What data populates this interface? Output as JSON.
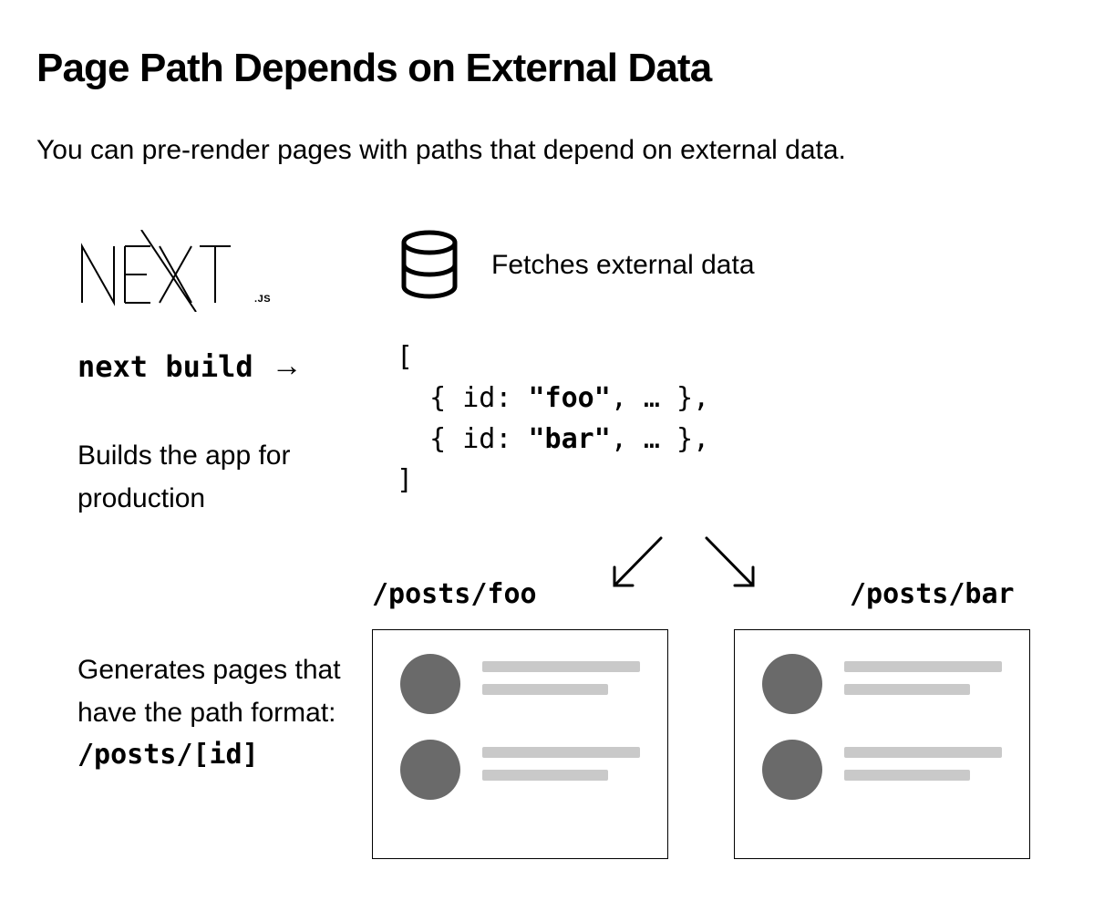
{
  "heading": "Page Path Depends  on External Data",
  "subtitle": "You can pre-render pages with paths that depend on external data.",
  "logo": {
    "text": "NEXT",
    "sub": ".JS"
  },
  "build": {
    "command": "next build",
    "arrowGlyph": "→",
    "description": "Builds the app for production"
  },
  "db": {
    "label": "Fetches external data"
  },
  "code": {
    "open": "[",
    "indent": "  { id: ",
    "key1": "\"foo\"",
    "key2": "\"bar\"",
    "rest": ", … },",
    "close": "]"
  },
  "paths": {
    "left": "/posts/foo",
    "right": "/posts/bar"
  },
  "generates": {
    "text": "Generates pages that have the path format:",
    "pattern": "/posts/[id]"
  }
}
